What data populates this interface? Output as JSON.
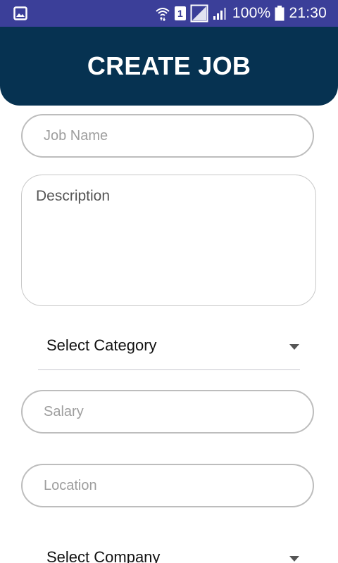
{
  "status_bar": {
    "battery": "100%",
    "time": "21:30",
    "sim_slot": "1",
    "colors": {
      "background": "#3b3f99"
    }
  },
  "header": {
    "title": "CREATE JOB",
    "colors": {
      "background": "#063251"
    }
  },
  "form": {
    "job_name": {
      "value": "",
      "placeholder": "Job Name"
    },
    "description": {
      "value": "",
      "placeholder": "Description"
    },
    "category": {
      "selected": "Select Category"
    },
    "salary": {
      "value": "",
      "placeholder": "Salary"
    },
    "location": {
      "value": "",
      "placeholder": "Location"
    },
    "company": {
      "selected": "Select Company"
    }
  },
  "icons": {
    "notification": "image-icon",
    "wifi": "wifi-icon",
    "sim": "sim-icon",
    "no_signal": "no-signal-icon",
    "signal": "signal-icon",
    "battery": "battery-icon",
    "dropdown": "dropdown-arrow-icon"
  }
}
